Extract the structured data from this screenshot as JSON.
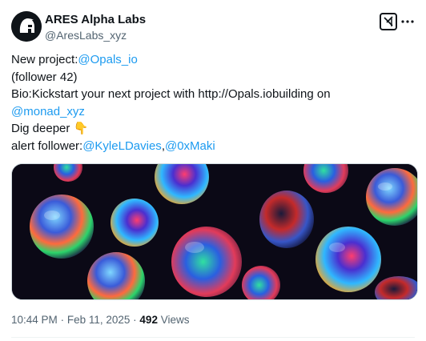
{
  "author": {
    "display_name": "ARES Alpha Labs",
    "handle": "@AresLabs_xyz"
  },
  "post": {
    "lines": [
      [
        {
          "t": "New project:"
        },
        {
          "t": "@Opals_io",
          "link": true
        }
      ],
      [
        {
          "t": "(follower 42)"
        }
      ],
      [
        {
          "t": "Bio:Kickstart your next project with http://Opals.iobuilding on"
        }
      ],
      [
        {
          "t": "@monad_xyz",
          "link": true
        }
      ],
      [
        {
          "t": "Dig deeper 👇"
        }
      ],
      [
        {
          "t": "alert follower:"
        },
        {
          "t": "@KyleLDavies",
          "link": true
        },
        {
          "t": ","
        },
        {
          "t": "@0xMaki",
          "link": true
        }
      ]
    ],
    "media_icon": "opal-stones-image"
  },
  "meta": {
    "time": "10:44 PM",
    "separator": "·",
    "date": "Feb 11, 2025",
    "views": "492",
    "views_label": "Views"
  },
  "icons": {
    "grok": "grok-icon",
    "more": "more-icon",
    "avatar": "spartan-helmet-avatar"
  },
  "colors": {
    "link": "#1d9bf0",
    "text": "#0f1419",
    "muted": "#536471"
  }
}
